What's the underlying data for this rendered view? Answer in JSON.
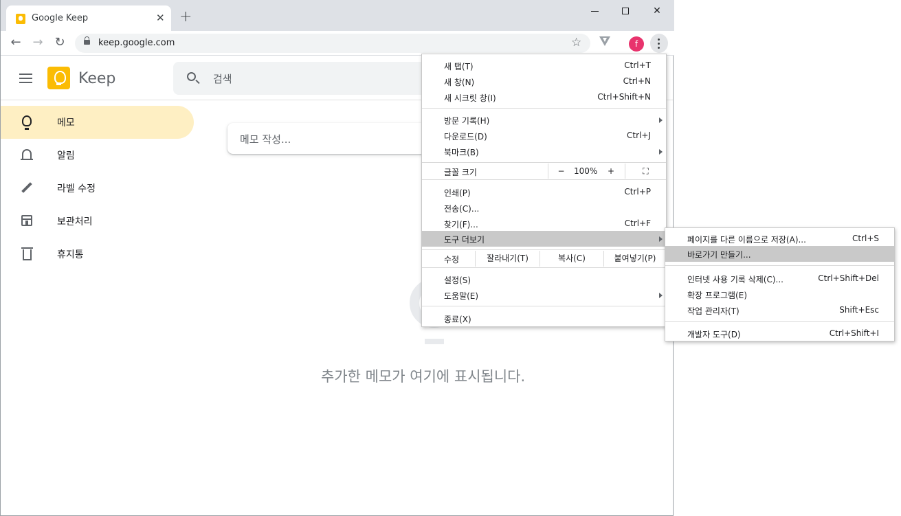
{
  "browser": {
    "tab_title": "Google Keep",
    "tab_close": "✕",
    "new_tab": "+",
    "url": "keep.google.com",
    "profile_initial": "f",
    "back_glyph": "←",
    "forward_glyph": "→",
    "reload_glyph": "↻",
    "star_glyph": "☆",
    "close_glyph": "✕"
  },
  "app": {
    "name": "Keep",
    "search_placeholder": "검색",
    "note_placeholder": "메모 작성...",
    "empty_message": "추가한 메모가 여기에 표시됩니다."
  },
  "sidebar": {
    "items": [
      {
        "label": "메모",
        "icon": "lightbulb-icon",
        "active": true
      },
      {
        "label": "알림",
        "icon": "bell-icon",
        "active": false
      },
      {
        "label": "라벨 수정",
        "icon": "pencil-icon",
        "active": false
      },
      {
        "label": "보관처리",
        "icon": "archive-icon",
        "active": false
      },
      {
        "label": "휴지통",
        "icon": "trash-icon",
        "active": false
      }
    ]
  },
  "menu": {
    "new_tab": {
      "label": "새 탭(T)",
      "shortcut": "Ctrl+T"
    },
    "new_window": {
      "label": "새 창(N)",
      "shortcut": "Ctrl+N"
    },
    "incognito": {
      "label": "새 시크릿 창(I)",
      "shortcut": "Ctrl+Shift+N"
    },
    "history": {
      "label": "방문 기록(H)"
    },
    "downloads": {
      "label": "다운로드(D)",
      "shortcut": "Ctrl+J"
    },
    "bookmarks": {
      "label": "북마크(B)"
    },
    "zoom": {
      "label": "글꼴 크기",
      "minus": "−",
      "value": "100%",
      "plus": "+",
      "fullscreen": "⛶"
    },
    "print": {
      "label": "인쇄(P)",
      "shortcut": "Ctrl+P"
    },
    "cast": {
      "label": "전송(C)..."
    },
    "find": {
      "label": "찾기(F)...",
      "shortcut": "Ctrl+F"
    },
    "more_tools": {
      "label": "도구 더보기"
    },
    "edit": {
      "label": "수정",
      "cut": "잘라내기(T)",
      "copy": "복사(C)",
      "paste": "붙여넣기(P)"
    },
    "settings": {
      "label": "설정(S)"
    },
    "help": {
      "label": "도움말(E)"
    },
    "exit": {
      "label": "종료(X)"
    }
  },
  "submenu": {
    "save_as": {
      "label": "페이지를 다른 이름으로 저장(A)...",
      "shortcut": "Ctrl+S"
    },
    "create_shortcut": {
      "label": "바로가기 만들기..."
    },
    "clear_data": {
      "label": "인터넷 사용 기록 삭제(C)...",
      "shortcut": "Ctrl+Shift+Del"
    },
    "extensions": {
      "label": "확장 프로그램(E)"
    },
    "task_manager": {
      "label": "작업 관리자(T)",
      "shortcut": "Shift+Esc"
    },
    "devtools": {
      "label": "개발자 도구(D)",
      "shortcut": "Ctrl+Shift+I"
    }
  },
  "colors": {
    "accent": "#fbbc04",
    "active_nav": "#feefc3",
    "menu_highlight": "#c9c9c9",
    "avatar": "#e8336d"
  }
}
